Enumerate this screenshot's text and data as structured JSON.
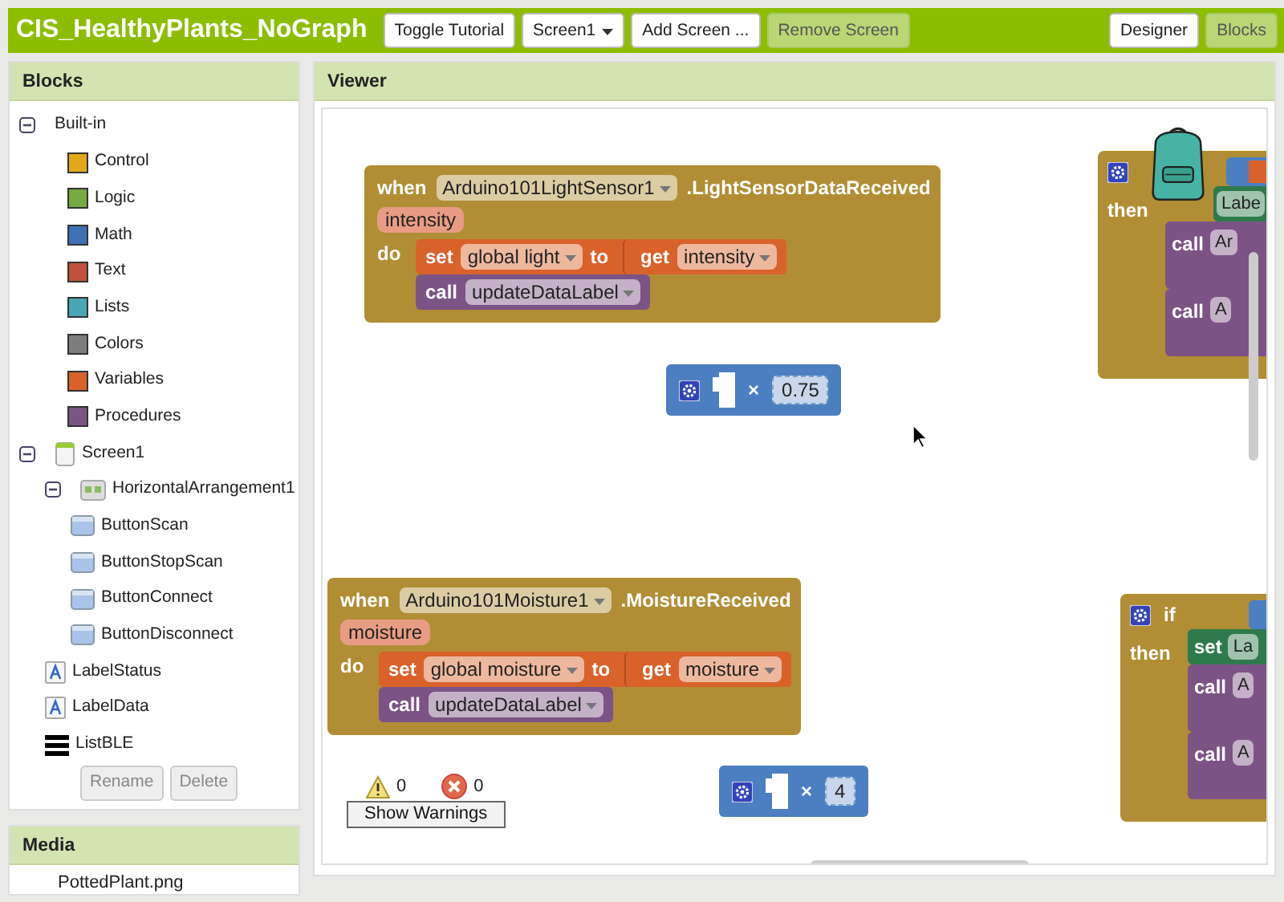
{
  "app_title": "CIS_HealthyPlants_NoGraph",
  "toolbar": [
    {
      "label": "Toggle Tutorial",
      "kind": "button",
      "disabled": false
    },
    {
      "label": "Screen1",
      "kind": "dropdown",
      "disabled": false
    },
    {
      "label": "Add Screen ...",
      "kind": "button",
      "disabled": false
    },
    {
      "label": "Remove Screen",
      "kind": "button",
      "disabled": true
    }
  ],
  "view_buttons": [
    {
      "label": "Designer",
      "selected": false
    },
    {
      "label": "Blocks",
      "selected": true
    }
  ],
  "blocks_panel": {
    "title": "Blocks",
    "tree": [
      {
        "label": "Built-in",
        "kind": "folder",
        "expanded": true,
        "children": [
          {
            "label": "Control",
            "kind": "category",
            "color": "#e1a91a"
          },
          {
            "label": "Logic",
            "kind": "category",
            "color": "#77ab41"
          },
          {
            "label": "Math",
            "kind": "category",
            "color": "#3f71b5"
          },
          {
            "label": "Text",
            "kind": "category",
            "color": "#c0523c"
          },
          {
            "label": "Lists",
            "kind": "category",
            "color": "#49a6b4"
          },
          {
            "label": "Colors",
            "kind": "category",
            "color": "#7d7d7d"
          },
          {
            "label": "Variables",
            "kind": "category",
            "color": "#d9622b"
          },
          {
            "label": "Procedures",
            "kind": "category",
            "color": "#7c5385"
          }
        ]
      },
      {
        "label": "Screen1",
        "kind": "screen",
        "expanded": true,
        "children": [
          {
            "label": "HorizontalArrangement1",
            "kind": "arrangement",
            "expanded": true,
            "children": [
              {
                "label": "ButtonScan",
                "kind": "button"
              },
              {
                "label": "ButtonStopScan",
                "kind": "button"
              },
              {
                "label": "ButtonConnect",
                "kind": "button"
              },
              {
                "label": "ButtonDisconnect",
                "kind": "button"
              }
            ]
          },
          {
            "label": "LabelStatus",
            "kind": "label"
          },
          {
            "label": "LabelData",
            "kind": "label"
          },
          {
            "label": "ListBLE",
            "kind": "listview"
          }
        ]
      }
    ],
    "buttons": [
      {
        "label": "Rename",
        "disabled": true
      },
      {
        "label": "Delete",
        "disabled": true
      }
    ]
  },
  "media_panel": {
    "title": "Media",
    "items": [
      "PottedPlant.png"
    ]
  },
  "viewer": {
    "title": "Viewer",
    "blocks": [
      {
        "kind": "event",
        "when": "when",
        "component": "Arduino101LightSensor1",
        "event": ".LightSensorDataReceived",
        "param": "intensity",
        "do": "do",
        "statements": [
          {
            "kind": "set",
            "set": "set",
            "variable": "global light",
            "to": "to",
            "get": "get",
            "value": "intensity"
          },
          {
            "kind": "call",
            "call": "call",
            "procedure": "updateDataLabel"
          }
        ]
      },
      {
        "kind": "if",
        "then": "then",
        "statements": [
          {
            "kind": "set_component",
            "variable": "Labe"
          },
          {
            "kind": "call",
            "call": "call",
            "procedure": "Ar"
          },
          {
            "kind": "call",
            "call": "call",
            "procedure": "A"
          }
        ]
      },
      {
        "kind": "multiply",
        "operator": "×",
        "value": "0.75"
      },
      {
        "kind": "event",
        "when": "when",
        "component": "Arduino101Moisture1",
        "event": ".MoistureReceived",
        "param": "moisture",
        "do": "do",
        "statements": [
          {
            "kind": "set",
            "set": "set",
            "variable": "global moisture",
            "to": "to",
            "get": "get",
            "value": "moisture"
          },
          {
            "kind": "call",
            "call": "call",
            "procedure": "updateDataLabel"
          }
        ]
      },
      {
        "kind": "if",
        "if": "if",
        "then": "then",
        "statements": [
          {
            "kind": "set_component",
            "set": "set",
            "variable": "La"
          },
          {
            "kind": "call",
            "call": "call",
            "procedure": "A"
          },
          {
            "kind": "call",
            "call": "call",
            "procedure": "A"
          }
        ]
      },
      {
        "kind": "multiply",
        "operator": "×",
        "value": "4"
      }
    ],
    "warnings": {
      "warning_count": "0",
      "error_count": "0",
      "button": "Show Warnings"
    }
  }
}
